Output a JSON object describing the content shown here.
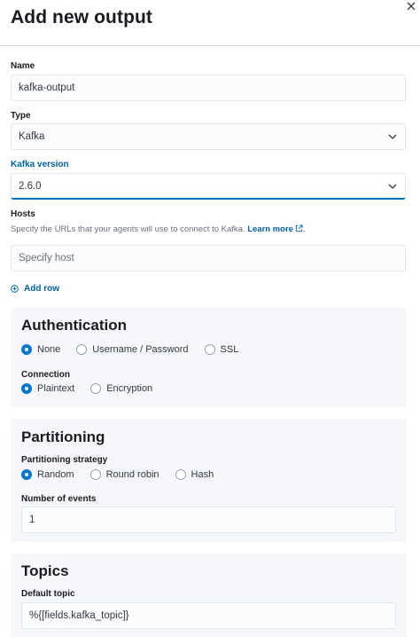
{
  "flyout": {
    "title": "Add new output"
  },
  "name": {
    "label": "Name",
    "value": "kafka-output"
  },
  "type": {
    "label": "Type",
    "value": "Kafka"
  },
  "kafka_version": {
    "label": "Kafka version",
    "value": "2.6.0"
  },
  "hosts": {
    "label": "Hosts",
    "help": "Specify the URLs that your agents will use to connect to Kafka.",
    "learn_more": "Learn more",
    "period": ".",
    "placeholder": "Specify host",
    "add_row": "Add row"
  },
  "authentication": {
    "title": "Authentication",
    "options": [
      "None",
      "Username / Password",
      "SSL"
    ],
    "selected": "None",
    "connection_label": "Connection",
    "connection_options": [
      "Plaintext",
      "Encryption"
    ],
    "connection_selected": "Plaintext"
  },
  "partitioning": {
    "title": "Partitioning",
    "strategy_label": "Partitioning strategy",
    "options": [
      "Random",
      "Round robin",
      "Hash"
    ],
    "selected": "Random",
    "events_label": "Number of events",
    "events_value": "1"
  },
  "topics": {
    "title": "Topics",
    "default_label": "Default topic",
    "default_value": "%{[fields.kafka_topic]}"
  },
  "colors": {
    "accent": "#0077cc",
    "link": "#0061a6",
    "panel_bg": "#f5f7fa"
  }
}
